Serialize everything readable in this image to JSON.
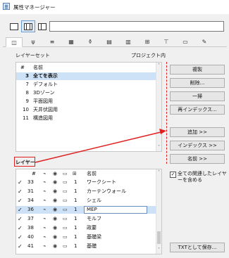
{
  "window": {
    "title": "属性マネージャー"
  },
  "toolbar": {
    "search_value": ""
  },
  "tabs": [
    {
      "icon": "layers-icon",
      "glyph": "◫"
    },
    {
      "icon": "pen-icon",
      "glyph": "ψ"
    },
    {
      "icon": "line-type-icon",
      "glyph": "≡"
    },
    {
      "icon": "fill-icon",
      "glyph": "▦"
    },
    {
      "icon": "surface-icon",
      "glyph": "⚱"
    },
    {
      "icon": "building-material-icon",
      "glyph": "▤"
    },
    {
      "icon": "composite-icon",
      "glyph": "▥"
    },
    {
      "icon": "profile-icon",
      "glyph": "⊞"
    },
    {
      "icon": "zone-icon",
      "glyph": "⊤"
    },
    {
      "icon": "mep-icon",
      "glyph": "▭"
    },
    {
      "icon": "markup-icon",
      "glyph": "✎"
    }
  ],
  "layer_sets": {
    "header_label": "レイヤーセット",
    "project_label": "プロジェクト内",
    "col_num": "#",
    "col_name": "名前",
    "items": [
      {
        "num": "3",
        "name": "全てを表示",
        "selected": true
      },
      {
        "num": "7",
        "name": "デフォルト",
        "selected": false
      },
      {
        "num": "8",
        "name": "3Dゾーン",
        "selected": false
      },
      {
        "num": "9",
        "name": "平面図用",
        "selected": false
      },
      {
        "num": "10",
        "name": "天井伏図用",
        "selected": false
      },
      {
        "num": "11",
        "name": "構造図用",
        "selected": false
      }
    ]
  },
  "buttons": {
    "duplicate": "複製",
    "delete": "削除...",
    "purge": "一掃",
    "reindex": "再インデックス...",
    "add": "追加 >>",
    "index": "インデックス >>",
    "name": "名前 >>",
    "save_txt": "TXTとして保存..."
  },
  "layers": {
    "header_label": "レイヤー",
    "col_num": "#",
    "col_name": "名前",
    "rows": [
      {
        "num": "33",
        "ver": "1",
        "name": "ワークシート",
        "editing": false
      },
      {
        "num": "31",
        "ver": "1",
        "name": "カーテンウォール",
        "editing": false
      },
      {
        "num": "34",
        "ver": "1",
        "name": "シェル",
        "editing": false
      },
      {
        "num": "36",
        "ver": "1",
        "name": "MEP",
        "editing": true
      },
      {
        "num": "37",
        "ver": "1",
        "name": "モルフ",
        "editing": false
      },
      {
        "num": "38",
        "ver": "1",
        "name": "政要",
        "editing": false
      },
      {
        "num": "40",
        "ver": "1",
        "name": "基礎梁",
        "editing": false
      },
      {
        "num": "41",
        "ver": "1",
        "name": "基礎",
        "editing": false
      }
    ]
  },
  "include_all": {
    "label_line1": "全ての関連したレイヤ",
    "label_line2": "ーを含める",
    "checked": true
  },
  "annotation": {
    "color": "#e02020"
  }
}
